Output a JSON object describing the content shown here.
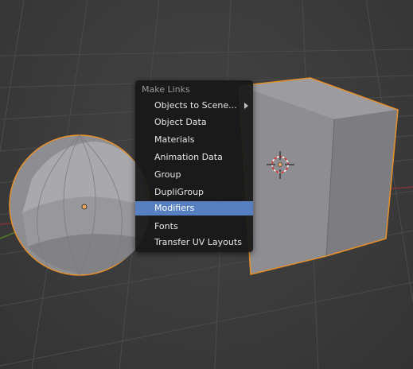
{
  "menu": {
    "title": "Make Links",
    "items": [
      {
        "label": "Objects to Scene...",
        "submenu": true,
        "active": false
      },
      {
        "label": "Object Data",
        "submenu": false,
        "active": false
      },
      {
        "label": "Materials",
        "submenu": false,
        "active": false
      },
      {
        "label": "Animation Data",
        "submenu": false,
        "active": false
      },
      {
        "label": "Group",
        "submenu": false,
        "active": false
      },
      {
        "label": "DupliGroup",
        "submenu": false,
        "active": false
      },
      {
        "label": "Modifiers",
        "submenu": false,
        "active": true
      },
      {
        "label": "Fonts",
        "submenu": false,
        "active": false
      },
      {
        "label": "Transfer UV Layouts",
        "submenu": false,
        "active": false
      }
    ]
  },
  "colors": {
    "viewport_bg": "#393939",
    "grid": "#4a4a4a",
    "selection_outline": "#e8902a",
    "menu_highlight": "#5680c2",
    "x_axis": "#8a3a3a",
    "y_axis": "#4e7a2e"
  }
}
